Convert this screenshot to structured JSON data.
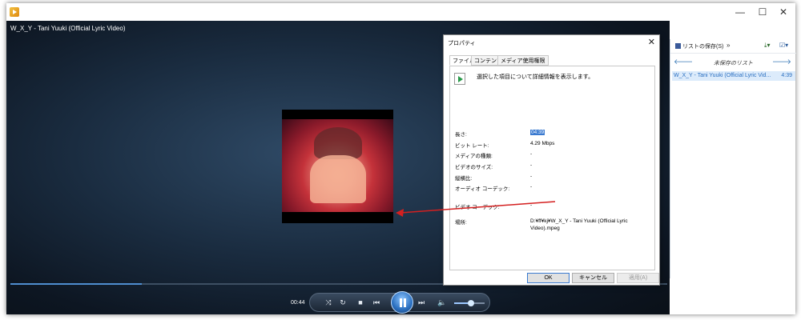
{
  "window": {
    "minimize": "—",
    "maximize": "☐",
    "close": "✕"
  },
  "player": {
    "title": "W_X_Y - Tani Yuuki (Official Lyric Video)",
    "time": "00:44",
    "progress_fraction": 0.2,
    "volume_fraction": 0.55,
    "switch_icon": "▪▪"
  },
  "playlist": {
    "save_label": "リストの保存(S)",
    "more": "»",
    "title": "未保存のリスト",
    "nav_prev": "🡐",
    "nav_next": "🡒",
    "tool1": "⤓▾",
    "tool2": "☑▾",
    "items": [
      {
        "title": "W_X_Y - Tani Yuuki (Official Lyric Vid...",
        "duration": "4:39"
      }
    ]
  },
  "dialog": {
    "title": "プロパティ",
    "close": "✕",
    "tabs": [
      "ファイル",
      "コンテンツ",
      "メディア使用権限"
    ],
    "description": "選択した項目について詳細情報を表示します。",
    "properties": [
      {
        "label": "長さ:",
        "value": "04:39"
      },
      {
        "label": "ビット レート:",
        "value": "4.29 Mbps"
      },
      {
        "label": "メディアの種類:",
        "value": "-"
      },
      {
        "label": "ビデオのサイズ:",
        "value": "-"
      },
      {
        "label": "縦横比:",
        "value": "-"
      },
      {
        "label": "オーディオ コーデック:",
        "value": "-"
      },
      {
        "label": "ビデオ コーデック:",
        "value": "-"
      },
      {
        "label": "場所:",
        "value": "D:¥ff¥kj¥W_X_Y - Tani Yuuki (Official Lyric Video).mpeg"
      }
    ],
    "buttons": {
      "ok": "OK",
      "cancel": "キャンセル",
      "apply": "適用(A)"
    }
  },
  "colors": {
    "accent": "#3a7ad0",
    "arrow": "#d42020",
    "player_bg": "#16263a"
  }
}
